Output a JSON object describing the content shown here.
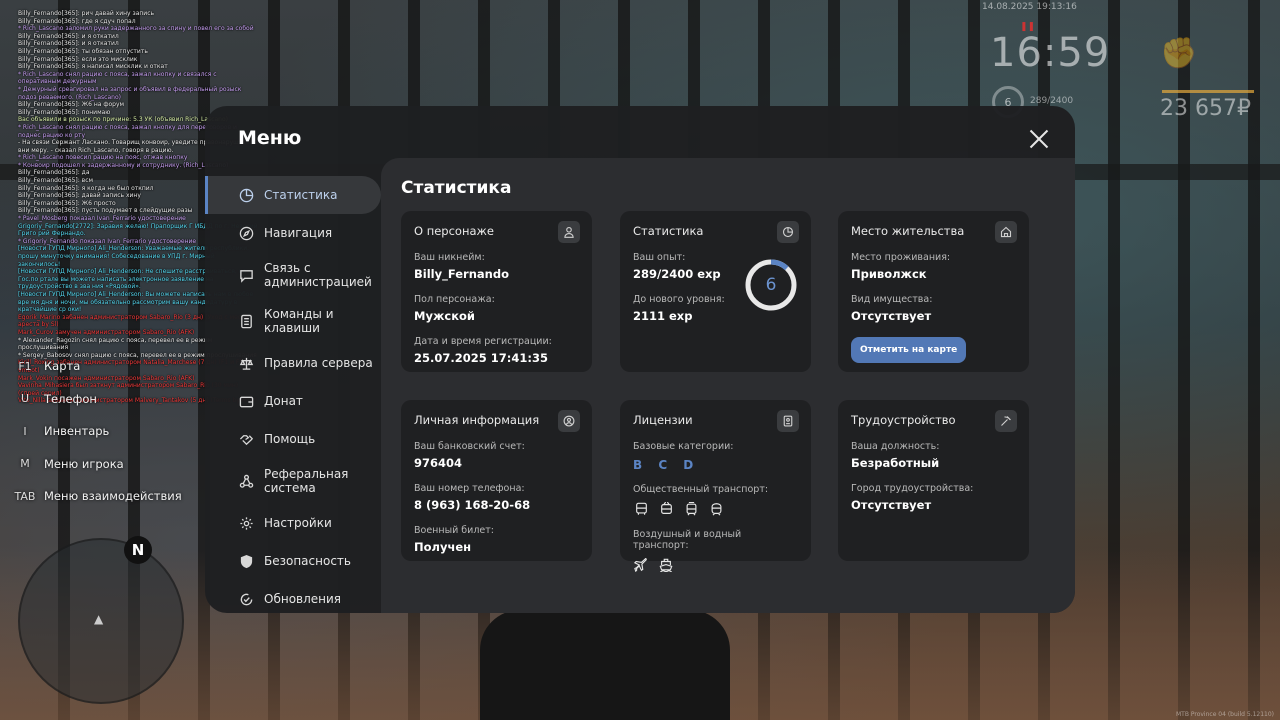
{
  "chat": [
    {
      "c": "white",
      "t": "Billy_Fernando[365]: рич давай хину запись"
    },
    {
      "c": "white",
      "t": "Billy_Fernando[365]: где я сдуч попал"
    },
    {
      "c": "purple",
      "t": "* Rich_Lascano заломил руки задержанного за спину и повел его за собой"
    },
    {
      "c": "white",
      "t": "Billy_Fernando[365]: и я откатил"
    },
    {
      "c": "white",
      "t": "Billy_Fernando[365]: и я откатил"
    },
    {
      "c": "white",
      "t": "Billy_Fernando[365]: ты обязан отпустить"
    },
    {
      "c": "white",
      "t": "Billy_Fernando[365]: если это мисклик"
    },
    {
      "c": "white",
      "t": "Billy_Fernando[365]: я написал мисклик и откат"
    },
    {
      "c": "purple",
      "t": "* Rich_Lascano снял рацию с пояса, зажал кнопку и связался с оперативным дежурным"
    },
    {
      "c": "purple",
      "t": "* Дежурный среагировал на запрос и объявил в федеральный розыск подоз реваемого. (Rich_Lascano)"
    },
    {
      "c": "white",
      "t": "Billy_Fernando[365]: Ж6 на форум"
    },
    {
      "c": "white",
      "t": "Billy_Fernando[365]: понимаю"
    },
    {
      "c": "lgreen",
      "t": "Вас объявили в розыск по причине: 5.3 УК (объявил Rich_Lascano)"
    },
    {
      "c": "purple",
      "t": "* Rich_Lascano снял рацию с пояса, зажал кнопку для переговоров и поднес рацию ко рту"
    },
    {
      "c": "white",
      "t": "- На связи Сержант Ласкано. Товарищ конвоир, уведите правонарушителя вни меру. - сказал Rich_Lascano, говоря в рацию."
    },
    {
      "c": "purple",
      "t": "* Rich_Lascano повесил рацию на пояс, отжав кнопку"
    },
    {
      "c": "purple",
      "t": "* Конвоир подошел к задержанному и сотруднику. (Rich_Lascano)"
    },
    {
      "c": "white",
      "t": "Billy_Fernando[365]: да"
    },
    {
      "c": "white",
      "t": "Billy_Fernando[365]: всм"
    },
    {
      "c": "white",
      "t": "Billy_Fernando[365]: я когда не был откпил"
    },
    {
      "c": "white",
      "t": "Billy_Fernando[365]: давай запись хину"
    },
    {
      "c": "white",
      "t": "Billy_Fernando[365]: Ж6 просто"
    },
    {
      "c": "white",
      "t": "Billy_Fernando[365]: пусть подумает в слейдущие разы"
    },
    {
      "c": "purple",
      "t": "* Pavel_Mosberg показал Ivan_Ferrario удостоверение"
    },
    {
      "c": "cyan",
      "t": "Grigoriy_Fernando[2772]: Заравия желаю! Прапорщик Г ИБДД по г. Невский Григо рий Фернандо."
    },
    {
      "c": "purple",
      "t": "* Grigoriy_Fernando показал Ivan_Ferrario удостоверение"
    },
    {
      "c": "cyan",
      "t": "[Новости ГУПД Мирного] Ali_Henderson: Уважаемые жители республики, прошу минуточку внимания! Собеседование в УПД г. Мирный закончилось!"
    },
    {
      "c": "cyan",
      "t": "[Новости ГУПД Мирного] Ali_Henderson: Не спешите расстраиваться, на Гос.по ртале вы можете написать электронное заявление на трудоустройство в зва ния «Рядовой»."
    },
    {
      "c": "cyan",
      "t": "[Новости ГУПД Мирного] Ali_Henderson: Вы можете написать нам в любое вре мя дня и ночи, мы обязательно рассмотрим вашу кандидатуру в кратчайшие ср оки!"
    },
    {
      "c": "red",
      "t": "Egorik_Marino забанен администратором Sabaro_Rio (3 дн) (Уход с места ареста by Sl)"
    },
    {
      "c": "red",
      "t": "Mark_Curov замучен администратором Sabaro_Rio (AFK)"
    },
    {
      "c": "white",
      "t": "* Alexander_Ragozin снял рацию с пояса, перевел ее в режим прослушивания"
    },
    {
      "c": "white",
      "t": "* Sergey_Babosov снял рацию с пояса, перевел ее в режим прослушивания"
    },
    {
      "c": "red",
      "t": "Kirill_Roxing забанен администратором Natalia_Marchese (7 дн) (F1 и F8 by vmbot)"
    },
    {
      "c": "red",
      "t": "Mark_Vokin посажен администратором Sabaro_Rio (AFK)"
    },
    {
      "c": "red",
      "t": "Vavinha_Mihasiera был заткнут администратором Sabaro_Rio (30 мин) (спрей серил)"
    },
    {
      "c": "red",
      "t": "Vito_Nilla забанен администратором Malvery_Tantakov (5 дн) (Terms by MTV)"
    }
  ],
  "hotkeys": [
    {
      "key": "F1",
      "label": "Карта"
    },
    {
      "key": "U",
      "label": "Телефон"
    },
    {
      "key": "I",
      "label": "Инвентарь"
    },
    {
      "key": "M",
      "label": "Меню игрока"
    },
    {
      "key": "TAB",
      "label": "Меню взаимодействия"
    }
  ],
  "radar": {
    "north": "N"
  },
  "hud": {
    "datetime": "14.08.2025 19:13:16",
    "time": "16:59",
    "level": "6",
    "exp": "289/2400",
    "money": "23 657₽",
    "build": "MTB Province 04 (build 5.12110)"
  },
  "menu": {
    "title": "Меню",
    "nav": [
      {
        "label": "Статистика",
        "icon": "chart-pie-icon",
        "active": true
      },
      {
        "label": "Навигация",
        "icon": "compass-icon"
      },
      {
        "label": "Связь с администрацией",
        "icon": "chat-icon"
      },
      {
        "label": "Команды и клавиши",
        "icon": "keyboard-icon"
      },
      {
        "label": "Правила сервера",
        "icon": "scales-icon"
      },
      {
        "label": "Донат",
        "icon": "wallet-icon"
      },
      {
        "label": "Помощь",
        "icon": "handshake-icon"
      },
      {
        "label": "Реферальная система",
        "icon": "network-icon"
      },
      {
        "label": "Настройки",
        "icon": "gear-icon"
      },
      {
        "label": "Безопасность",
        "icon": "shield-icon"
      },
      {
        "label": "Обновления",
        "icon": "refresh-check-icon"
      }
    ]
  },
  "stats": {
    "title": "Статистика",
    "character": {
      "title": "О персонаже",
      "nickname_label": "Ваш никнейм:",
      "nickname": "Billy_Fernando",
      "gender_label": "Пол персонажа:",
      "gender": "Мужской",
      "reg_label": "Дата и время регистрации:",
      "reg": "25.07.2025 17:41:35"
    },
    "statistics": {
      "title": "Статистика",
      "exp_label": "Ваш опыт:",
      "exp": "289/2400 exp",
      "next_label": "До нового уровня:",
      "next": "2111 exp",
      "level": "6",
      "progress": 0.12
    },
    "residence": {
      "title": "Место жительства",
      "place_label": "Место проживания:",
      "place": "Приволжск",
      "property_label": "Вид имущества:",
      "property": "Отсутствует",
      "map_button": "Отметить на карте"
    },
    "personal": {
      "title": "Личная информация",
      "bank_label": "Ваш банковский счет:",
      "bank": "976404",
      "phone_label": "Ваш номер телефона:",
      "phone": "8 (963) 168-20-68",
      "military_label": "Военный билет:",
      "military": "Получен"
    },
    "licenses": {
      "title": "Лицензии",
      "base_label": "Базовые категории:",
      "base": "B C D",
      "public_label": "Общественный транспорт:",
      "air_label": "Воздушный и водный транспорт:"
    },
    "employment": {
      "title": "Трудоустройство",
      "position_label": "Ваша должность:",
      "position": "Безработный",
      "city_label": "Город трудоустройства:",
      "city": "Отсутствует"
    }
  },
  "colors": {
    "accent": "#5b84c4",
    "button": "#5278b6",
    "panel": "#1f2022"
  }
}
